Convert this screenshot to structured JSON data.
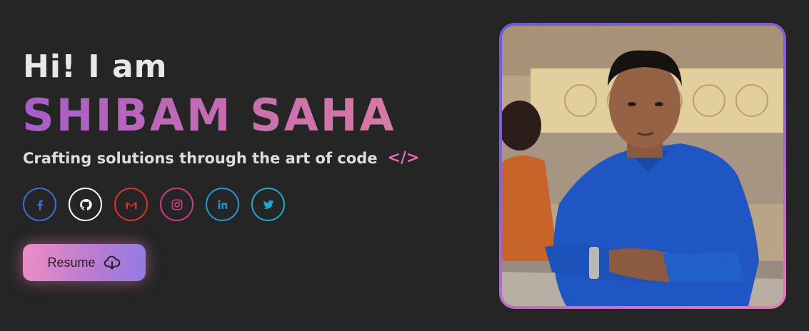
{
  "hero": {
    "greeting": "Hi! I am",
    "name": "SHIBAM SAHA",
    "tagline": "Crafting solutions through the art of code",
    "code_glyph": "</>",
    "resume_label": "Resume"
  },
  "socials": [
    {
      "network": "facebook",
      "icon": "facebook-icon",
      "color": "#3b6fd8"
    },
    {
      "network": "github",
      "icon": "github-icon",
      "color": "#ffffff"
    },
    {
      "network": "gmail",
      "icon": "gmail-icon",
      "color": "#d6342f"
    },
    {
      "network": "instagram",
      "icon": "instagram-icon",
      "color": "#d13a82"
    },
    {
      "network": "linkedin",
      "icon": "linkedin-icon",
      "color": "#2496d4"
    },
    {
      "network": "twitter",
      "icon": "twitter-icon",
      "color": "#24a7cf"
    }
  ],
  "colors": {
    "background": "#252525",
    "name_gradient": [
      "#a45ec6",
      "#d77aa5"
    ],
    "accent_pink": "#e56bb1",
    "frame_gradient": [
      "#6b5bd8",
      "#e779b3"
    ]
  },
  "photo": {
    "subject": "profile-photo"
  }
}
